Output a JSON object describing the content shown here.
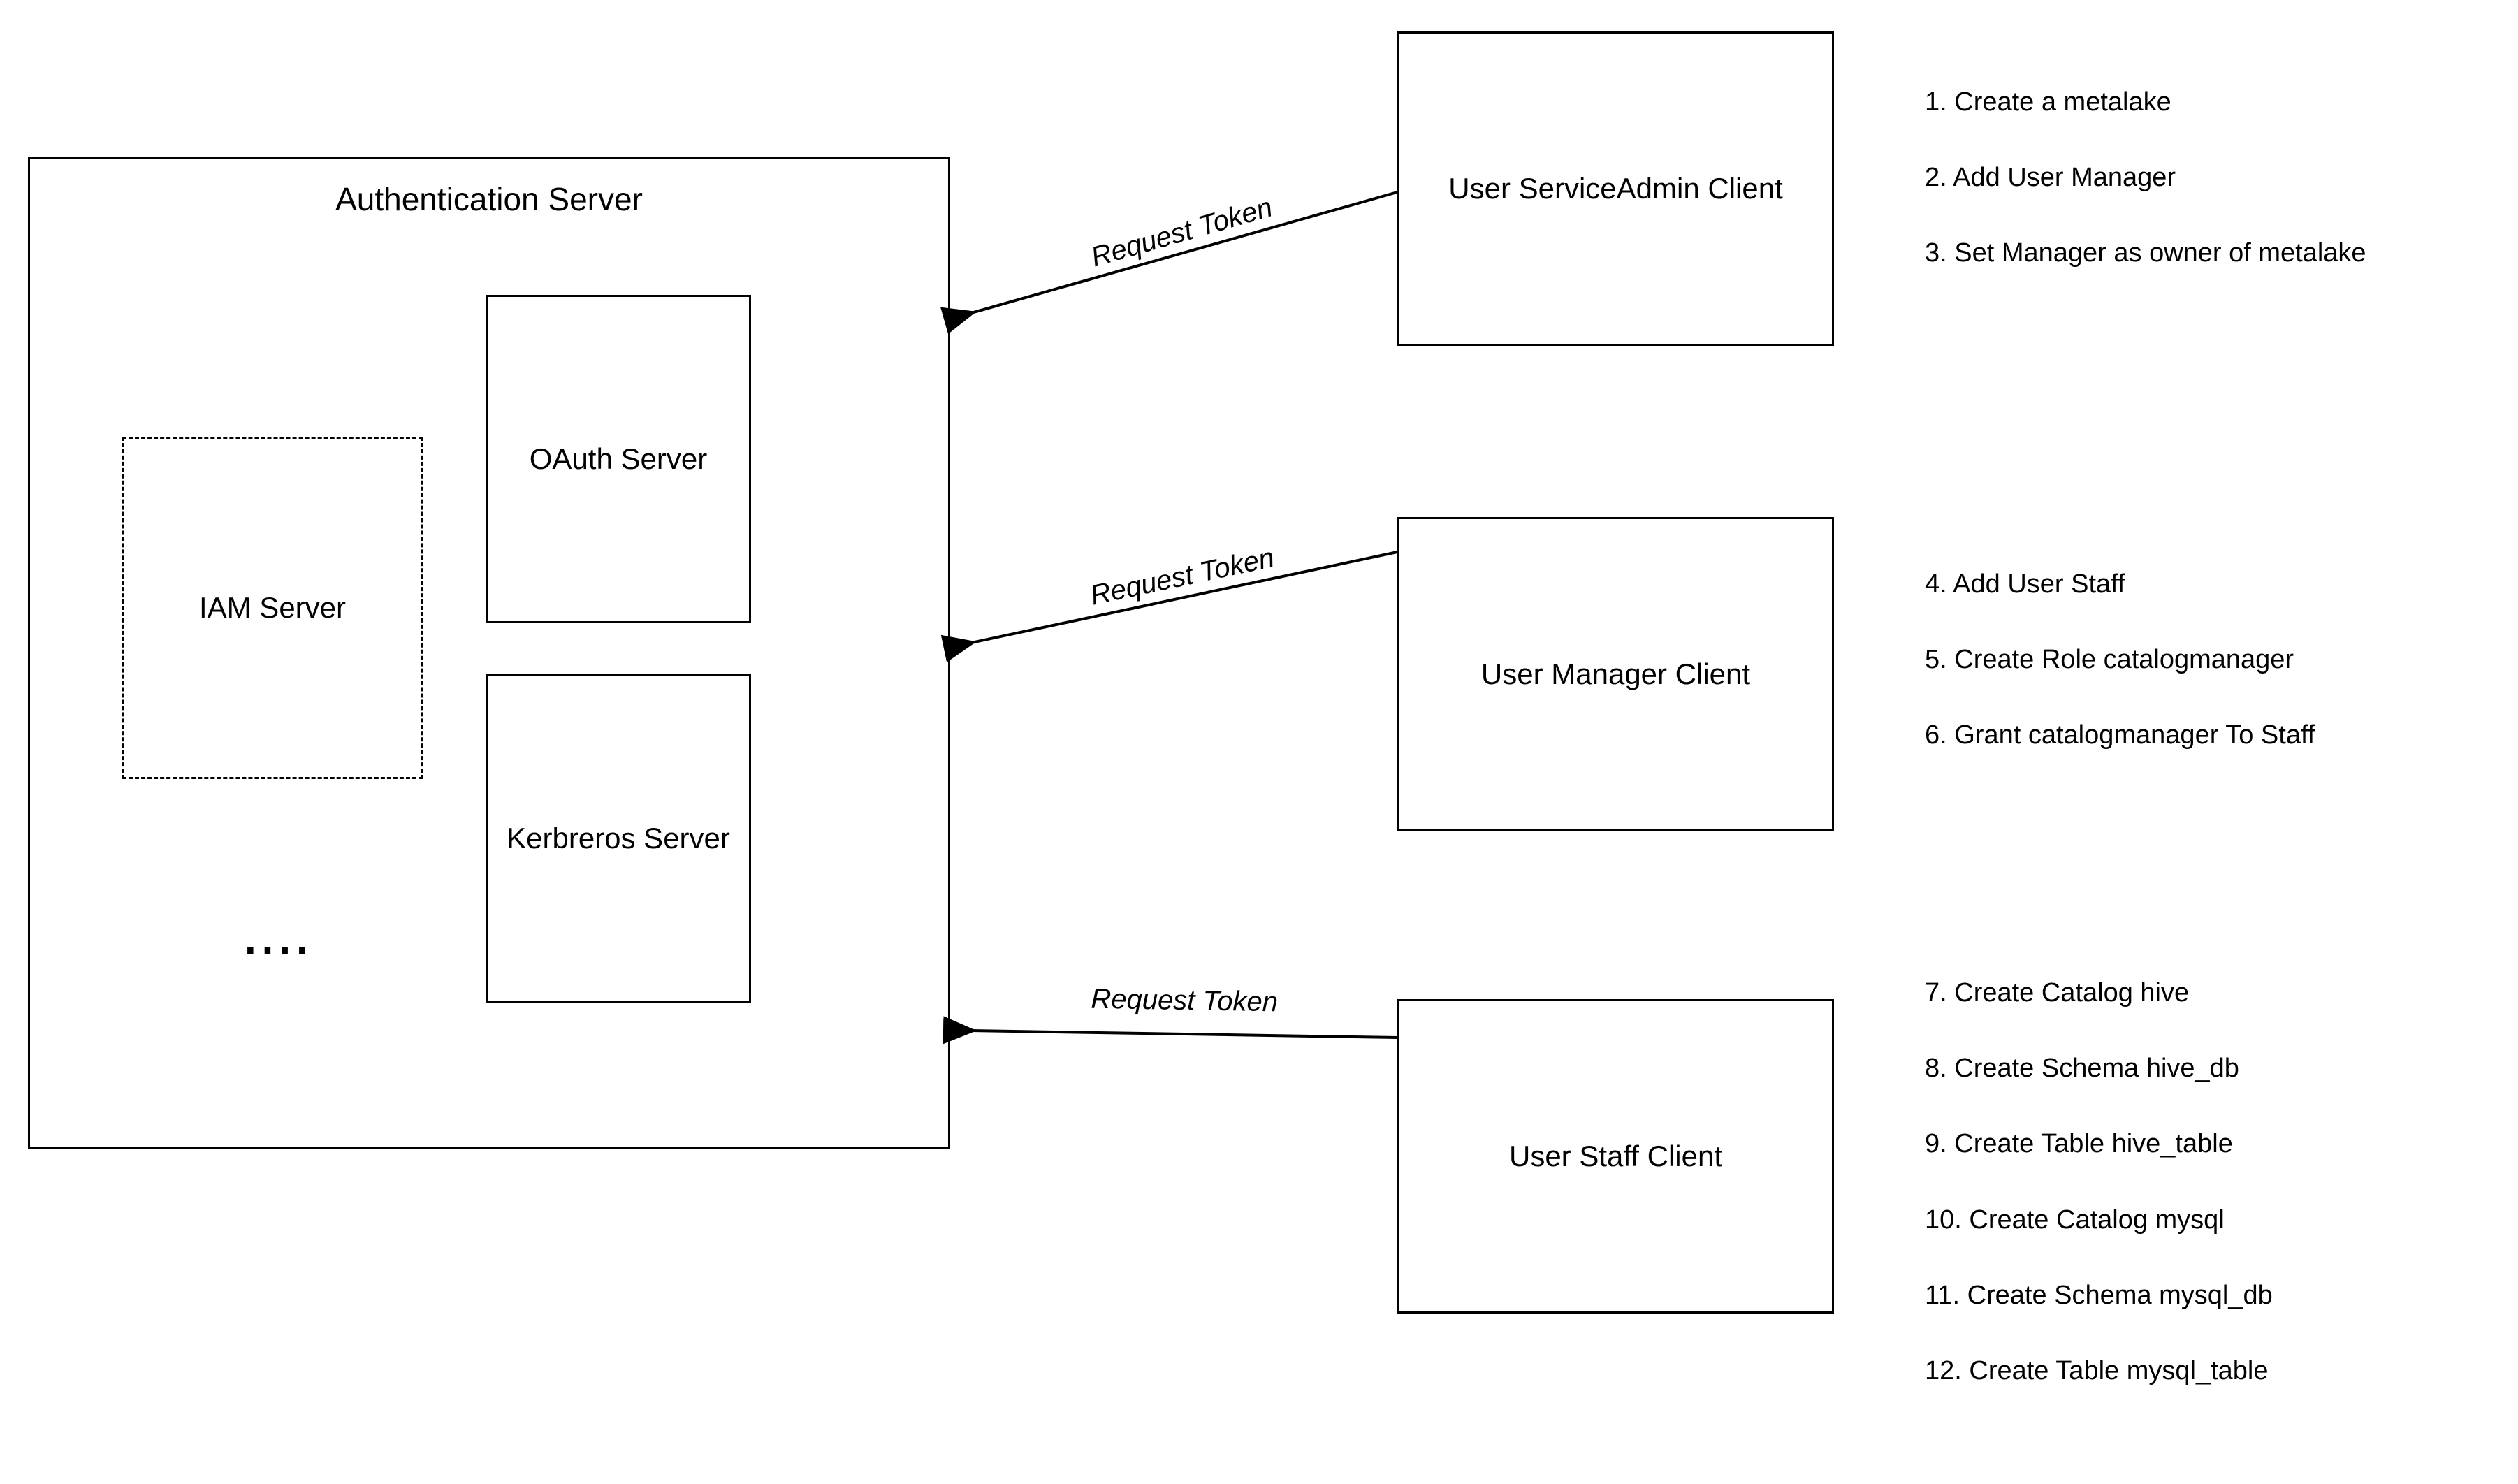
{
  "auth_server": {
    "title": "Authentication Server",
    "iam": "IAM Server",
    "oauth": "OAuth Server",
    "kerberos": "Kerbreros Server",
    "ellipsis": "...."
  },
  "clients": {
    "service_admin": "User ServiceAdmin Client",
    "manager": "User Manager Client",
    "staff": "User Staff Client"
  },
  "arrows": {
    "label1": "Request Token",
    "label2": "Request Token",
    "label3": "Request Token"
  },
  "steps": {
    "s1": "1. Create a metalake",
    "s2": "2. Add  User Manager",
    "s3": "3. Set Manager as owner of metalake",
    "s4": "4. Add User Staff",
    "s5": "5. Create Role catalogmanager",
    "s6": "6. Grant catalogmanager  To Staff",
    "s7": "7. Create Catalog hive",
    "s8": "8. Create Schema hive_db",
    "s9": "9. Create Table hive_table",
    "s10": "10. Create Catalog mysql",
    "s11": "11. Create Schema mysql_db",
    "s12": "12. Create Table mysql_table"
  }
}
